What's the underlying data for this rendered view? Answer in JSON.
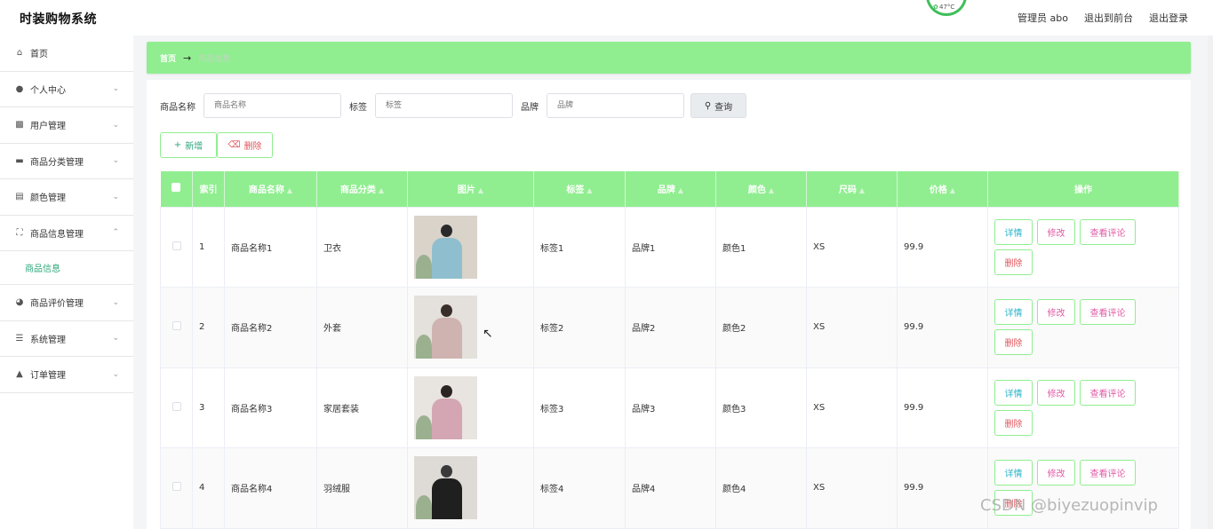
{
  "header": {
    "brand": "时装购物系统",
    "weather_temp": "47°C",
    "admin_label": "管理员 abo",
    "back_to_front": "退出到前台",
    "logout": "退出登录"
  },
  "sidebar": {
    "items": [
      {
        "label": "首页",
        "icon": "home-icon"
      },
      {
        "label": "个人中心",
        "icon": "user-icon"
      },
      {
        "label": "用户管理",
        "icon": "users-chart-icon"
      },
      {
        "label": "商品分类管理",
        "icon": "briefcase-icon"
      },
      {
        "label": "颜色管理",
        "icon": "clipboard-icon"
      },
      {
        "label": "商品信息管理",
        "icon": "expand-icon"
      },
      {
        "label": "商品评价管理",
        "icon": "compass-icon"
      },
      {
        "label": "系统管理",
        "icon": "list-icon"
      },
      {
        "label": "订单管理",
        "icon": "tag-icon"
      }
    ],
    "active_sub": "商品信息"
  },
  "breadcrumb": {
    "home": "首页",
    "current": "商品信息"
  },
  "search": {
    "name_label": "商品名称",
    "name_placeholder": "商品名称",
    "tag_label": "标签",
    "tag_placeholder": "标签",
    "brand_label": "品牌",
    "brand_placeholder": "品牌",
    "query_label": "查询"
  },
  "actions": {
    "add_label": "新增",
    "delete_label": "删除"
  },
  "table": {
    "headers": [
      "索引",
      "商品名称",
      "商品分类",
      "图片",
      "标签",
      "品牌",
      "颜色",
      "尺码",
      "价格",
      "操作"
    ],
    "op_detail": "详情",
    "op_edit": "修改",
    "op_review": "查看评论",
    "op_delete": "删除",
    "rows": [
      {
        "index": "1",
        "name": "商品名称1",
        "category": "卫衣",
        "tag": "标签1",
        "brand": "品牌1",
        "color": "颜色1",
        "size": "XS",
        "price": "99.9"
      },
      {
        "index": "2",
        "name": "商品名称2",
        "category": "外套",
        "tag": "标签2",
        "brand": "品牌2",
        "color": "颜色2",
        "size": "XS",
        "price": "99.9"
      },
      {
        "index": "3",
        "name": "商品名称3",
        "category": "家居套装",
        "tag": "标签3",
        "brand": "品牌3",
        "color": "颜色3",
        "size": "XS",
        "price": "99.9"
      },
      {
        "index": "4",
        "name": "商品名称4",
        "category": "羽绒服",
        "tag": "标签4",
        "brand": "品牌4",
        "color": "颜色4",
        "size": "XS",
        "price": "99.9"
      }
    ]
  },
  "watermark": "CSDN @biyezuopinvip",
  "colors": {
    "accent_green": "#90ee90",
    "link_teal": "#2fa77c"
  }
}
